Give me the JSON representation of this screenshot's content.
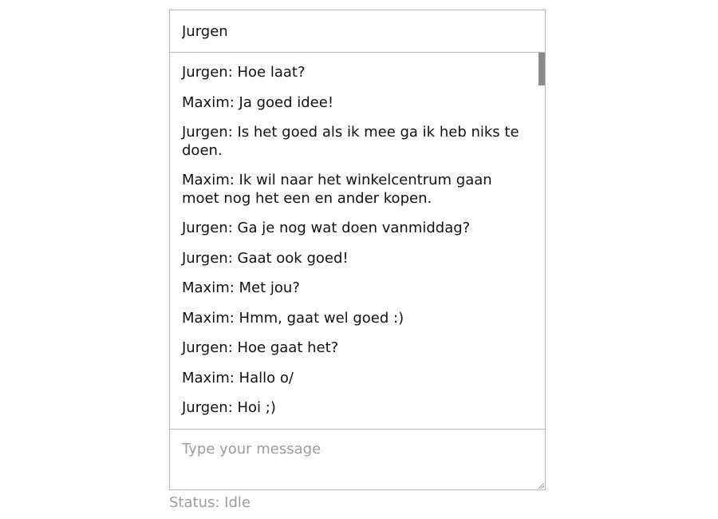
{
  "name_field": {
    "value": "Jurgen"
  },
  "messages": [
    {
      "text": "Jurgen: Hoe laat?"
    },
    {
      "text": "Maxim: Ja goed idee!"
    },
    {
      "text": "Jurgen: Is het goed als ik mee ga ik heb niks te doen."
    },
    {
      "text": "Maxim: Ik wil naar het winkelcentrum gaan moet nog het een en ander kopen."
    },
    {
      "text": "Jurgen: Ga je nog wat doen vanmiddag?"
    },
    {
      "text": "Jurgen: Gaat ook goed!"
    },
    {
      "text": "Maxim: Met jou?"
    },
    {
      "text": "Maxim: Hmm, gaat wel goed :)"
    },
    {
      "text": "Jurgen: Hoe gaat het?"
    },
    {
      "text": "Maxim: Hallo o/"
    },
    {
      "text": "Jurgen: Hoi ;)"
    }
  ],
  "message_field": {
    "value": "",
    "placeholder": "Type your message"
  },
  "status": {
    "text": "Status: Idle"
  },
  "icons": {
    "scrollbar": "scrollbar-thumb",
    "resize": "resize-grip-icon"
  },
  "colors": {
    "border": "#b9b9b9",
    "placeholder": "#9c9c9c",
    "scroll_thumb": "#8a8a8a"
  }
}
